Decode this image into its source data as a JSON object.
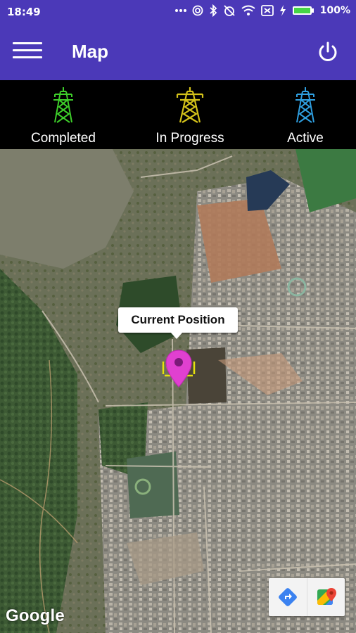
{
  "status_bar": {
    "time": "18:49",
    "battery": "100%",
    "icons": [
      "dots-icon",
      "hotspot-icon",
      "bluetooth-icon",
      "alarm-off-icon",
      "wifi-icon",
      "sim-off-icon",
      "charging-icon",
      "battery-icon"
    ]
  },
  "app_bar": {
    "title": "Map",
    "menu_icon": "hamburger-menu-icon",
    "action_icon": "power-icon",
    "background": "#4b39b8"
  },
  "legend": {
    "items": [
      {
        "label": "Completed",
        "icon": "transmission-tower-icon",
        "color": "#3ecf2a"
      },
      {
        "label": "In Progress",
        "icon": "transmission-tower-icon",
        "color": "#d4c21a"
      },
      {
        "label": "Active",
        "icon": "transmission-tower-icon",
        "color": "#2f9fe0"
      }
    ]
  },
  "map": {
    "marker": {
      "title": "Current Position",
      "pin_color": "#e040d0",
      "ring_color": "#e6e10f"
    },
    "controls": [
      {
        "name": "directions-icon",
        "color": "#3b82f0"
      },
      {
        "name": "google-maps-icon",
        "color": "#34a853"
      }
    ],
    "attribution": "Google"
  }
}
